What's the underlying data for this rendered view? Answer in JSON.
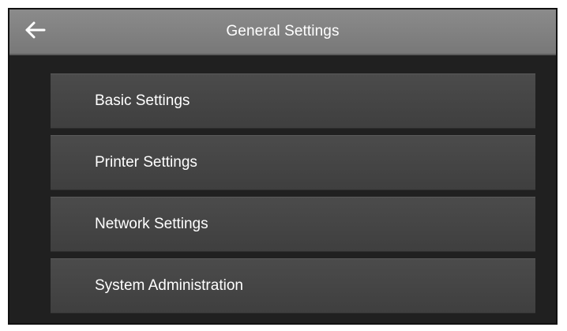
{
  "header": {
    "title": "General Settings",
    "back_icon": "back-arrow-icon"
  },
  "menu": {
    "items": [
      {
        "label": "Basic Settings"
      },
      {
        "label": "Printer Settings"
      },
      {
        "label": "Network Settings"
      },
      {
        "label": "System Administration"
      }
    ]
  },
  "colors": {
    "header_bg": "#828282",
    "screen_bg": "#202020",
    "item_bg": "#464646",
    "text": "#ffffff"
  }
}
